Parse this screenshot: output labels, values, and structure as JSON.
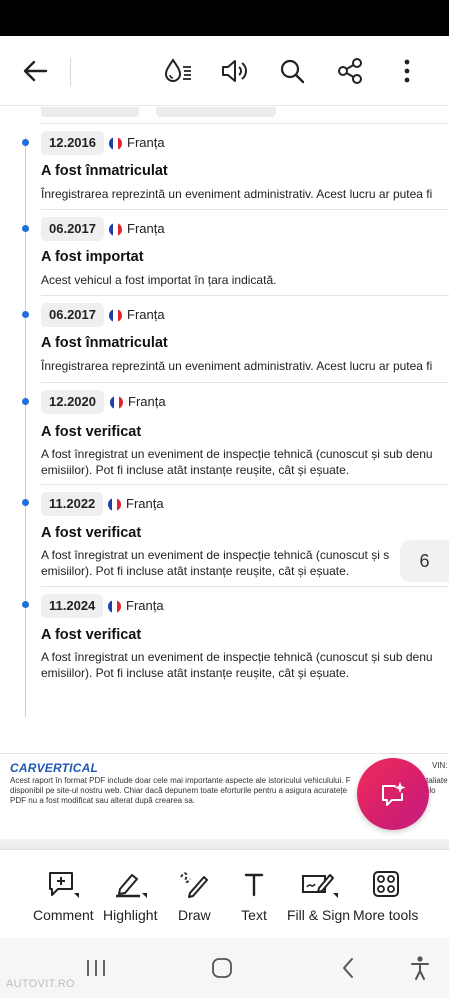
{
  "topbar": {
    "back_icon": "arrow-left-icon",
    "icons": [
      "liquid-mode-icon",
      "read-aloud-icon",
      "search-icon",
      "share-icon",
      "more-vertical-icon"
    ]
  },
  "events": [
    {
      "date": "12.2016",
      "country": "Franța",
      "title": "A fost înmatriculat",
      "desc": [
        "Înregistrarea reprezintă un eveniment administrativ. Acest lucru ar putea fi"
      ]
    },
    {
      "date": "06.2017",
      "country": "Franța",
      "title": "A fost importat",
      "desc": [
        "Acest vehicul a fost importat în țara indicată."
      ]
    },
    {
      "date": "06.2017",
      "country": "Franța",
      "title": "A fost înmatriculat",
      "desc": [
        "Înregistrarea reprezintă un eveniment administrativ. Acest lucru ar putea fi"
      ]
    },
    {
      "date": "12.2020",
      "country": "Franța",
      "title": "A fost verificat",
      "desc": [
        "A fost înregistrat un eveniment de inspecție tehnică (cunoscut și sub denu",
        "emisiilor). Pot fi incluse atât instanțe reușite, cât și eșuate."
      ]
    },
    {
      "date": "11.2022",
      "country": "Franța",
      "title": "A fost verificat",
      "desc": [
        "A fost înregistrat un eveniment de inspecție tehnică (cunoscut și s",
        "emisiilor). Pot fi incluse atât instanțe reușite, cât și eșuate."
      ]
    },
    {
      "date": "11.2024",
      "country": "Franța",
      "title": "A fost verificat",
      "desc": [
        "A fost înregistrat un eveniment de inspecție tehnică (cunoscut și sub denu",
        "emisiilor). Pot fi incluse atât instanțe reușite, cât și eșuate."
      ]
    }
  ],
  "page_indicator": "6",
  "footer": {
    "brand": "CARVERTICAL",
    "vin_label": "VIN:",
    "disclaimer": [
      "Acest raport în format PDF include doar cele mai importante aspecte ale istoricului vehiculului. F                                  taliate",
      "disponibil pe site-ul nostru web. Chiar dacă depunem toate eforturile pentru a asigura acuratețe                              datelo",
      "PDF nu a fost modificat sau alterat după crearea sa."
    ]
  },
  "toolbar": {
    "tools": [
      {
        "label": "Comment",
        "icon": "comment-icon"
      },
      {
        "label": "Highlight",
        "icon": "highlight-icon"
      },
      {
        "label": "Draw",
        "icon": "draw-icon"
      },
      {
        "label": "Text",
        "icon": "text-icon"
      },
      {
        "label": "Fill & Sign",
        "icon": "fill-sign-icon"
      },
      {
        "label": "More tools",
        "icon": "more-tools-icon"
      }
    ]
  },
  "navbar": {
    "icons": [
      "recent-apps-icon",
      "home-icon",
      "back-icon",
      "accessibility-icon"
    ]
  },
  "watermark": "AUTOVIT.RO",
  "colors": {
    "accent_blue": "#1e6fdc",
    "fab_pink": "#e0245e",
    "brand_blue": "#1e5ab4"
  }
}
